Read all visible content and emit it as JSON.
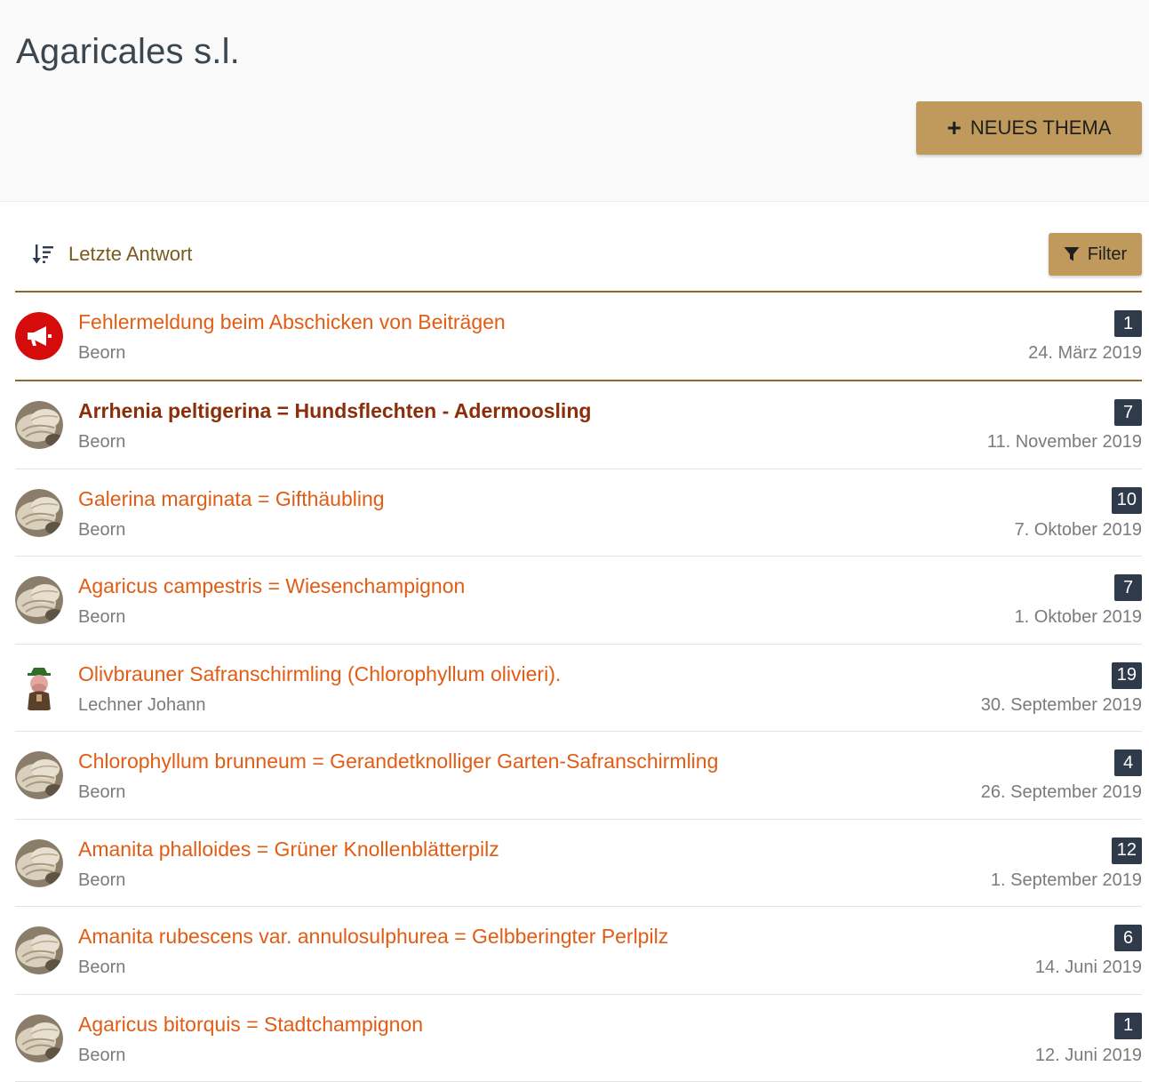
{
  "header": {
    "title": "Agaricales s.l.",
    "new_topic_label": "NEUES THEMA"
  },
  "toolbar": {
    "sort_label": "Letzte Antwort",
    "filter_label": "Filter"
  },
  "colors": {
    "accent": "#bf9a5c",
    "link": "#e15c14",
    "link_unread": "#8b2e0a",
    "badge": "#2f3b4a",
    "divider": "#8a6a2f"
  },
  "topics": [
    {
      "title": "Fehlermeldung beim Abschicken von Beiträgen",
      "author": "Beorn",
      "replies": "1",
      "date": "24. März 2019",
      "avatar": "announcement-icon",
      "bold": false
    },
    {
      "title": "Arrhenia peltigerina = Hundsflechten - Adermoosling",
      "author": "Beorn",
      "replies": "7",
      "date": "11. November 2019",
      "avatar": "mushroom-photo",
      "bold": true
    },
    {
      "title": "Galerina marginata = Gifthäubling",
      "author": "Beorn",
      "replies": "10",
      "date": "7. Oktober 2019",
      "avatar": "mushroom-photo",
      "bold": false
    },
    {
      "title": "Agaricus campestris = Wiesenchampignon",
      "author": "Beorn",
      "replies": "7",
      "date": "1. Oktober 2019",
      "avatar": "mushroom-photo",
      "bold": false
    },
    {
      "title": "Olivbrauner Safranschirmling (Chlorophyllum olivieri).",
      "author": "Lechner Johann",
      "replies": "19",
      "date": "30. September 2019",
      "avatar": "gnome-figure",
      "bold": false
    },
    {
      "title": "Chlorophyllum brunneum = Gerandetknolliger Garten-Safranschirmling",
      "author": "Beorn",
      "replies": "4",
      "date": "26. September 2019",
      "avatar": "mushroom-photo",
      "bold": false
    },
    {
      "title": "Amanita phalloides = Grüner Knollenblätterpilz",
      "author": "Beorn",
      "replies": "12",
      "date": "1. September 2019",
      "avatar": "mushroom-photo",
      "bold": false
    },
    {
      "title": "Amanita rubescens var. annulosulphurea = Gelbberingter Perlpilz",
      "author": "Beorn",
      "replies": "6",
      "date": "14. Juni 2019",
      "avatar": "mushroom-photo",
      "bold": false
    },
    {
      "title": "Agaricus bitorquis = Stadtchampignon",
      "author": "Beorn",
      "replies": "1",
      "date": "12. Juni 2019",
      "avatar": "mushroom-photo",
      "bold": false
    }
  ]
}
